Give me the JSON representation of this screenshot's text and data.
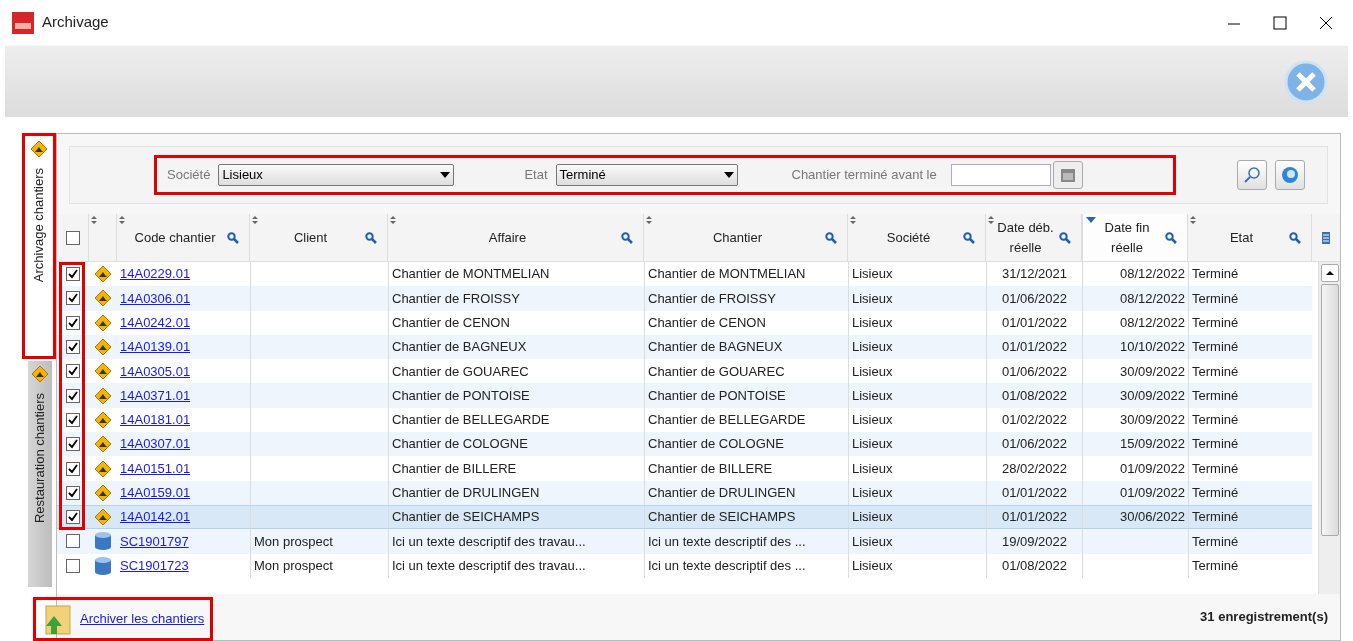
{
  "window": {
    "title": "Archivage"
  },
  "side_tabs": [
    {
      "label": "Archivage chantiers",
      "selected": true
    },
    {
      "label": "Restauration chantiers",
      "selected": false
    }
  ],
  "filters": {
    "societe_label": "Société",
    "societe_value": "Lisieux",
    "etat_label": "Etat",
    "etat_value": "Terminé",
    "date_label": "Chantier terminé avant le"
  },
  "table": {
    "columns": [
      {
        "label": "Code chantier",
        "sorted": false
      },
      {
        "label": "Client",
        "sorted": false
      },
      {
        "label": "Affaire",
        "sorted": false
      },
      {
        "label": "Chantier",
        "sorted": false
      },
      {
        "label": "Société",
        "sorted": false
      },
      {
        "label": "Date déb. réelle",
        "sorted": false
      },
      {
        "label": "Date fin réelle",
        "sorted": true
      },
      {
        "label": "Etat",
        "sorted": false
      }
    ],
    "header_checked": false,
    "rows": [
      {
        "kind": "site",
        "checked": true,
        "selected": false,
        "cells": [
          "14A0229.01",
          "",
          "Chantier de MONTMELIAN",
          "Chantier de MONTMELIAN",
          "Lisieux",
          "31/12/2021",
          "08/12/2022",
          "Terminé"
        ]
      },
      {
        "kind": "site",
        "checked": true,
        "selected": false,
        "cells": [
          "14A0306.01",
          "",
          "Chantier de FROISSY",
          "Chantier de FROISSY",
          "Lisieux",
          "01/06/2022",
          "08/12/2022",
          "Terminé"
        ]
      },
      {
        "kind": "site",
        "checked": true,
        "selected": false,
        "cells": [
          "14A0242.01",
          "",
          "Chantier de CENON",
          "Chantier de CENON",
          "Lisieux",
          "01/01/2022",
          "08/12/2022",
          "Terminé"
        ]
      },
      {
        "kind": "site",
        "checked": true,
        "selected": false,
        "cells": [
          "14A0139.01",
          "",
          "Chantier de BAGNEUX",
          "Chantier de BAGNEUX",
          "Lisieux",
          "01/01/2022",
          "10/10/2022",
          "Terminé"
        ]
      },
      {
        "kind": "site",
        "checked": true,
        "selected": false,
        "cells": [
          "14A0305.01",
          "",
          "Chantier de GOUAREC",
          "Chantier de GOUAREC",
          "Lisieux",
          "01/06/2022",
          "30/09/2022",
          "Terminé"
        ]
      },
      {
        "kind": "site",
        "checked": true,
        "selected": false,
        "cells": [
          "14A0371.01",
          "",
          "Chantier de PONTOISE",
          "Chantier de PONTOISE",
          "Lisieux",
          "01/08/2022",
          "30/09/2022",
          "Terminé"
        ]
      },
      {
        "kind": "site",
        "checked": true,
        "selected": false,
        "cells": [
          "14A0181.01",
          "",
          "Chantier de BELLEGARDE",
          "Chantier de BELLEGARDE",
          "Lisieux",
          "01/02/2022",
          "30/09/2022",
          "Terminé"
        ]
      },
      {
        "kind": "site",
        "checked": true,
        "selected": false,
        "cells": [
          "14A0307.01",
          "",
          "Chantier de COLOGNE",
          "Chantier de COLOGNE",
          "Lisieux",
          "01/06/2022",
          "15/09/2022",
          "Terminé"
        ]
      },
      {
        "kind": "site",
        "checked": true,
        "selected": false,
        "cells": [
          "14A0151.01",
          "",
          "Chantier de BILLERE",
          "Chantier de BILLERE",
          "Lisieux",
          "28/02/2022",
          "01/09/2022",
          "Terminé"
        ]
      },
      {
        "kind": "site",
        "checked": true,
        "selected": false,
        "cells": [
          "14A0159.01",
          "",
          "Chantier de DRULINGEN",
          "Chantier de DRULINGEN",
          "Lisieux",
          "01/01/2022",
          "01/09/2022",
          "Terminé"
        ]
      },
      {
        "kind": "site",
        "checked": true,
        "selected": true,
        "cells": [
          "14A0142.01",
          "",
          "Chantier de SEICHAMPS",
          "Chantier de SEICHAMPS",
          "Lisieux",
          "01/01/2022",
          "30/06/2022",
          "Terminé"
        ]
      },
      {
        "kind": "prospect",
        "checked": false,
        "selected": false,
        "cells": [
          "SC1901797",
          "Mon prospect",
          "Ici un texte descriptif des travau...",
          "Ici un texte descriptif des ...",
          "Lisieux",
          "19/09/2022",
          "",
          "Terminé"
        ]
      },
      {
        "kind": "prospect",
        "checked": false,
        "selected": false,
        "cells": [
          "SC1901723",
          "Mon prospect",
          "Ici un texte descriptif des travau...",
          "Ici un texte descriptif des ...",
          "Lisieux",
          "01/08/2022",
          "",
          "Terminé"
        ]
      }
    ]
  },
  "footer": {
    "action": "Archiver les chantiers",
    "count": "31 enregistrement(s)"
  }
}
